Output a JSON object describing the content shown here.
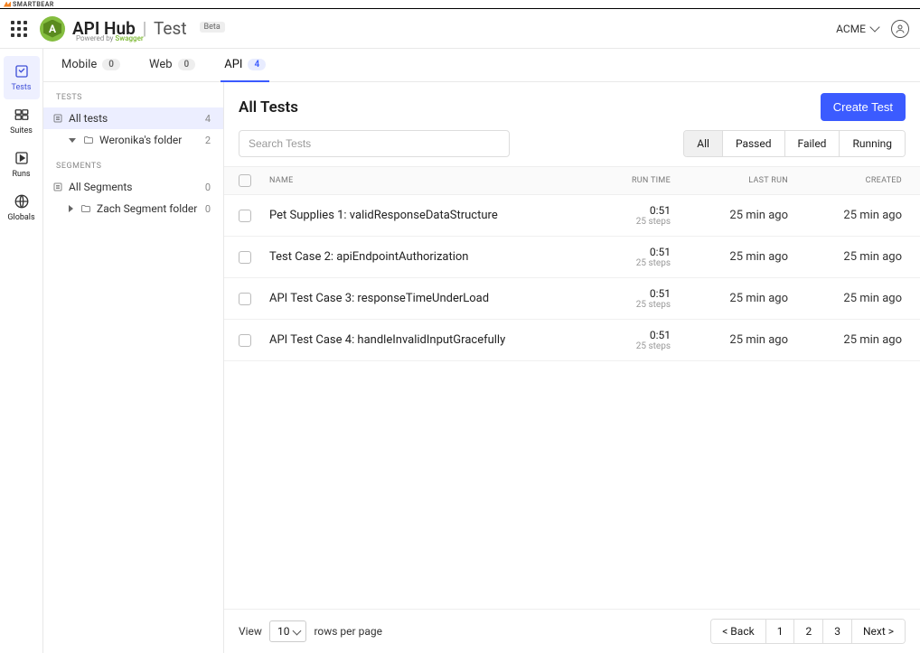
{
  "topbar": {
    "brand": "SMARTBEAR"
  },
  "header": {
    "logo_letter": "A",
    "title": "API Hub",
    "section": "Test",
    "badge": "Beta",
    "powered_prefix": "Powered by ",
    "powered_brand": "Swagger",
    "org": "ACME"
  },
  "leftnav": [
    {
      "id": "tests",
      "label": "Tests",
      "active": true
    },
    {
      "id": "suites",
      "label": "Suites",
      "active": false
    },
    {
      "id": "runs",
      "label": "Runs",
      "active": false
    },
    {
      "id": "globals",
      "label": "Globals",
      "active": false
    }
  ],
  "tabs": [
    {
      "label": "Mobile",
      "count": "0",
      "active": false
    },
    {
      "label": "Web",
      "count": "0",
      "active": false
    },
    {
      "label": "API",
      "count": "4",
      "active": true
    }
  ],
  "tree": {
    "tests_header": "TESTS",
    "all_tests": {
      "label": "All tests",
      "count": "4"
    },
    "folder1": {
      "label": "Weronika's folder",
      "count": "2"
    },
    "segments_header": "SEGMENTS",
    "all_segments": {
      "label": "All Segments",
      "count": "0"
    },
    "segfolder": {
      "label": "Zach Segment folder",
      "count": "0"
    }
  },
  "page": {
    "title": "All Tests",
    "create_btn": "Create Test",
    "search_placeholder": "Search Tests",
    "filters": [
      "All",
      "Passed",
      "Failed",
      "Running"
    ],
    "filter_active": 0,
    "columns": {
      "name": "NAME",
      "runtime": "RUN TIME",
      "lastrun": "LAST RUN",
      "created": "CREATED"
    },
    "rows": [
      {
        "name": "Pet Supplies 1: validResponseDataStructure",
        "runtime": "0:51",
        "steps": "25 steps",
        "lastrun": "25 min ago",
        "created": "25 min ago"
      },
      {
        "name": "Test Case 2: apiEndpointAuthorization",
        "runtime": "0:51",
        "steps": "25 steps",
        "lastrun": "25 min ago",
        "created": "25 min ago"
      },
      {
        "name": "API Test Case 3: responseTimeUnderLoad",
        "runtime": "0:51",
        "steps": "25 steps",
        "lastrun": "25 min ago",
        "created": "25 min ago"
      },
      {
        "name": "API Test Case 4: handleInvalidInputGracefully",
        "runtime": "0:51",
        "steps": "25 steps",
        "lastrun": "25 min ago",
        "created": "25 min ago"
      }
    ]
  },
  "footer": {
    "view": "View",
    "rows_value": "10",
    "rows_suffix": "rows per page",
    "pager": {
      "back": "< Back",
      "pages": [
        "1",
        "2",
        "3"
      ],
      "next": "Next >"
    }
  }
}
